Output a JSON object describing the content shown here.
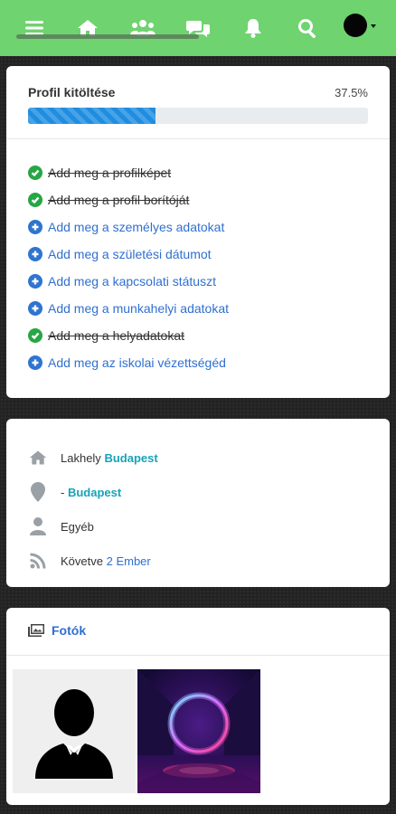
{
  "nav": {
    "icons": [
      "menu-icon",
      "home-icon",
      "users-icon",
      "chat-icon",
      "bell-icon",
      "search-icon",
      "avatar"
    ],
    "accent_color": "#6fd36f"
  },
  "profile_completion": {
    "title": "Profil kitöltése",
    "percent_label": "37.5%",
    "progress": 0.375,
    "progress_color": "#1f8de0",
    "tasks": [
      {
        "label": "Add meg a profilképet",
        "done": true
      },
      {
        "label": "Add meg a profil borítóját",
        "done": true
      },
      {
        "label": "Add meg a személyes adatokat",
        "done": false
      },
      {
        "label": "Add meg a születési dátumot",
        "done": false
      },
      {
        "label": "Add meg a kapcsolati státuszt",
        "done": false
      },
      {
        "label": "Add meg a munkahelyi adatokat",
        "done": false
      },
      {
        "label": "Add meg a helyadatokat",
        "done": true
      },
      {
        "label": "Add meg az iskolai vézettségéd",
        "done": false
      }
    ]
  },
  "info": {
    "residence_label": "Lakhely",
    "residence_value": "Budapest",
    "origin_prefix": "-",
    "origin_value": "Budapest",
    "other_label": "Egyéb",
    "following_label": "Követve",
    "following_value": "2 Ember"
  },
  "photos": {
    "title": "Fotók",
    "items": [
      "default-avatar-photo",
      "neon-ring-photo"
    ]
  }
}
